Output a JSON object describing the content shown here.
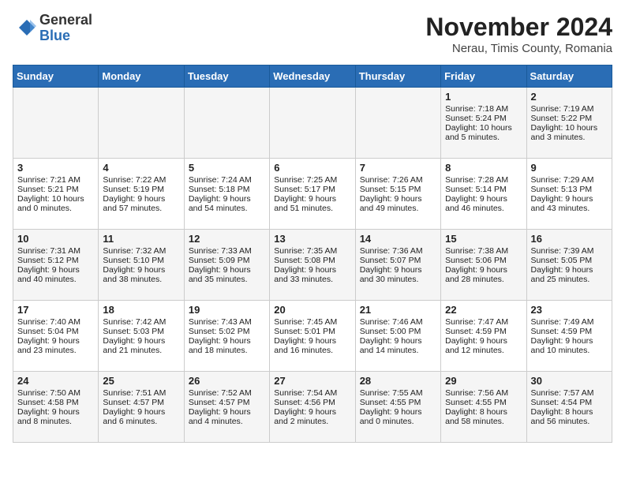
{
  "header": {
    "logo_line1": "General",
    "logo_line2": "Blue",
    "month": "November 2024",
    "location": "Nerau, Timis County, Romania"
  },
  "weekdays": [
    "Sunday",
    "Monday",
    "Tuesday",
    "Wednesday",
    "Thursday",
    "Friday",
    "Saturday"
  ],
  "rows": [
    [
      {
        "day": "",
        "info": ""
      },
      {
        "day": "",
        "info": ""
      },
      {
        "day": "",
        "info": ""
      },
      {
        "day": "",
        "info": ""
      },
      {
        "day": "",
        "info": ""
      },
      {
        "day": "1",
        "info": "Sunrise: 7:18 AM\nSunset: 5:24 PM\nDaylight: 10 hours and 5 minutes."
      },
      {
        "day": "2",
        "info": "Sunrise: 7:19 AM\nSunset: 5:22 PM\nDaylight: 10 hours and 3 minutes."
      }
    ],
    [
      {
        "day": "3",
        "info": "Sunrise: 7:21 AM\nSunset: 5:21 PM\nDaylight: 10 hours and 0 minutes."
      },
      {
        "day": "4",
        "info": "Sunrise: 7:22 AM\nSunset: 5:19 PM\nDaylight: 9 hours and 57 minutes."
      },
      {
        "day": "5",
        "info": "Sunrise: 7:24 AM\nSunset: 5:18 PM\nDaylight: 9 hours and 54 minutes."
      },
      {
        "day": "6",
        "info": "Sunrise: 7:25 AM\nSunset: 5:17 PM\nDaylight: 9 hours and 51 minutes."
      },
      {
        "day": "7",
        "info": "Sunrise: 7:26 AM\nSunset: 5:15 PM\nDaylight: 9 hours and 49 minutes."
      },
      {
        "day": "8",
        "info": "Sunrise: 7:28 AM\nSunset: 5:14 PM\nDaylight: 9 hours and 46 minutes."
      },
      {
        "day": "9",
        "info": "Sunrise: 7:29 AM\nSunset: 5:13 PM\nDaylight: 9 hours and 43 minutes."
      }
    ],
    [
      {
        "day": "10",
        "info": "Sunrise: 7:31 AM\nSunset: 5:12 PM\nDaylight: 9 hours and 40 minutes."
      },
      {
        "day": "11",
        "info": "Sunrise: 7:32 AM\nSunset: 5:10 PM\nDaylight: 9 hours and 38 minutes."
      },
      {
        "day": "12",
        "info": "Sunrise: 7:33 AM\nSunset: 5:09 PM\nDaylight: 9 hours and 35 minutes."
      },
      {
        "day": "13",
        "info": "Sunrise: 7:35 AM\nSunset: 5:08 PM\nDaylight: 9 hours and 33 minutes."
      },
      {
        "day": "14",
        "info": "Sunrise: 7:36 AM\nSunset: 5:07 PM\nDaylight: 9 hours and 30 minutes."
      },
      {
        "day": "15",
        "info": "Sunrise: 7:38 AM\nSunset: 5:06 PM\nDaylight: 9 hours and 28 minutes."
      },
      {
        "day": "16",
        "info": "Sunrise: 7:39 AM\nSunset: 5:05 PM\nDaylight: 9 hours and 25 minutes."
      }
    ],
    [
      {
        "day": "17",
        "info": "Sunrise: 7:40 AM\nSunset: 5:04 PM\nDaylight: 9 hours and 23 minutes."
      },
      {
        "day": "18",
        "info": "Sunrise: 7:42 AM\nSunset: 5:03 PM\nDaylight: 9 hours and 21 minutes."
      },
      {
        "day": "19",
        "info": "Sunrise: 7:43 AM\nSunset: 5:02 PM\nDaylight: 9 hours and 18 minutes."
      },
      {
        "day": "20",
        "info": "Sunrise: 7:45 AM\nSunset: 5:01 PM\nDaylight: 9 hours and 16 minutes."
      },
      {
        "day": "21",
        "info": "Sunrise: 7:46 AM\nSunset: 5:00 PM\nDaylight: 9 hours and 14 minutes."
      },
      {
        "day": "22",
        "info": "Sunrise: 7:47 AM\nSunset: 4:59 PM\nDaylight: 9 hours and 12 minutes."
      },
      {
        "day": "23",
        "info": "Sunrise: 7:49 AM\nSunset: 4:59 PM\nDaylight: 9 hours and 10 minutes."
      }
    ],
    [
      {
        "day": "24",
        "info": "Sunrise: 7:50 AM\nSunset: 4:58 PM\nDaylight: 9 hours and 8 minutes."
      },
      {
        "day": "25",
        "info": "Sunrise: 7:51 AM\nSunset: 4:57 PM\nDaylight: 9 hours and 6 minutes."
      },
      {
        "day": "26",
        "info": "Sunrise: 7:52 AM\nSunset: 4:57 PM\nDaylight: 9 hours and 4 minutes."
      },
      {
        "day": "27",
        "info": "Sunrise: 7:54 AM\nSunset: 4:56 PM\nDaylight: 9 hours and 2 minutes."
      },
      {
        "day": "28",
        "info": "Sunrise: 7:55 AM\nSunset: 4:55 PM\nDaylight: 9 hours and 0 minutes."
      },
      {
        "day": "29",
        "info": "Sunrise: 7:56 AM\nSunset: 4:55 PM\nDaylight: 8 hours and 58 minutes."
      },
      {
        "day": "30",
        "info": "Sunrise: 7:57 AM\nSunset: 4:54 PM\nDaylight: 8 hours and 56 minutes."
      }
    ]
  ]
}
